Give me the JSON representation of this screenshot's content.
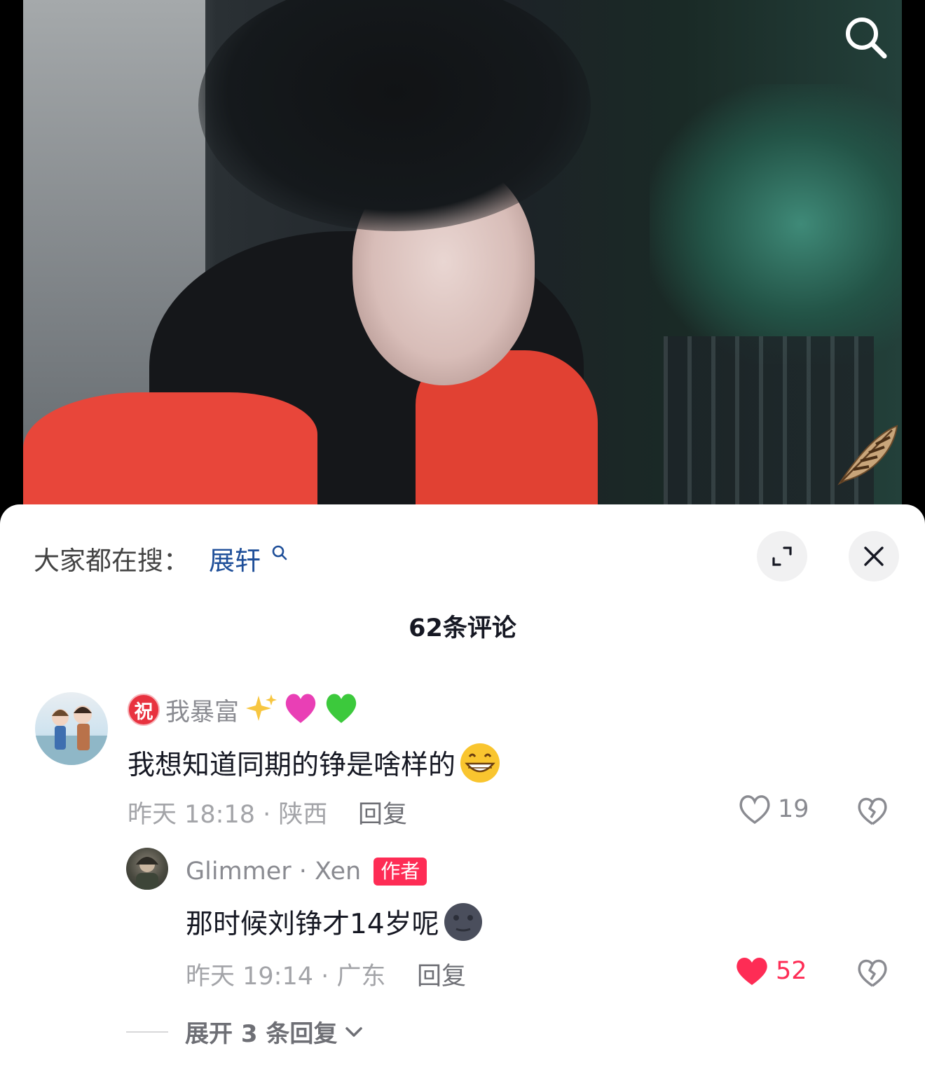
{
  "video": {
    "search_icon": "search-icon",
    "feather_icon": "feather-icon"
  },
  "header": {
    "everyone_searching_label": "大家都在搜：",
    "trending_keyword": "展轩",
    "expand_icon": "expand-icon",
    "close_icon": "close-icon"
  },
  "comments_header": {
    "count_label": "62条评论"
  },
  "comments": [
    {
      "badge": "祝",
      "username": "我暴富",
      "username_emojis": [
        "✨",
        "💗",
        "💚"
      ],
      "text": "我想知道同期的铮是啥样的",
      "text_emoji": "😁",
      "time_location": "昨天 18:18 · 陕西",
      "reply_label": "回复",
      "likes": "19",
      "liked": false
    }
  ],
  "replies": [
    {
      "username": "Glimmer · Xen",
      "author_badge": "作者",
      "text": "那时候刘铮才14岁呢",
      "text_emoji": "🌚",
      "time_location": "昨天 19:14 · 广东",
      "reply_label": "回复",
      "likes": "52",
      "liked": true
    }
  ],
  "expand_replies": {
    "label": "展开 3 条回复"
  },
  "colors": {
    "like_active": "#fe2c55",
    "keyword_link": "#1f4f99",
    "author_badge": "#fe2c55",
    "badge_red": "#e8323f"
  }
}
